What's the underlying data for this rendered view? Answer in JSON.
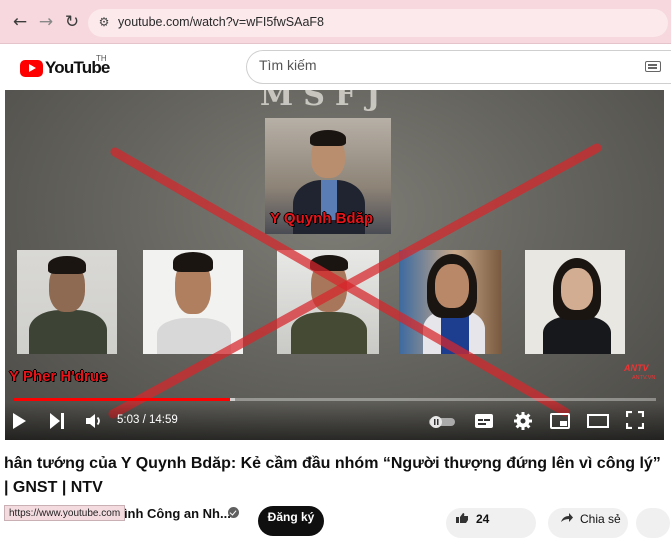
{
  "browser": {
    "url": "youtube.com/watch?v=wFI5fwSAaF8",
    "back_icon": "arrow-left-icon",
    "forward_icon": "arrow-right-icon",
    "reload_icon": "reload-icon"
  },
  "youtube": {
    "logo_text": "YouTube",
    "country_code": "TH",
    "search_placeholder": "Tìm kiếm"
  },
  "video": {
    "overlay_title": "MSFJ",
    "label_top": "Y Quynh Bdăp",
    "label_bottom": "Y Pher H'drue",
    "watermark": "ANTV",
    "watermark_sub": "ANTV.VN",
    "current_time": "5:03",
    "duration": "14:59",
    "time_display": "5:03 / 14:59",
    "progress_fraction": 0.337,
    "buffer_fraction": 0.345
  },
  "meta": {
    "title": "hân tướng của Y Quynh Bdăp: Kẻ cầm đầu nhóm “Người thượng đứng lên vì công lý” | GNST | NTV",
    "status_url": "https://www.youtube.com",
    "channel_name": "Truyền hình Công an Nh...",
    "channel_visible": "hình Công an Nh...",
    "subscribe_label": "Đăng ký",
    "like_count": "24",
    "share_label": "Chia sẻ"
  },
  "colors": {
    "brand_red": "#ff0000",
    "browser_bar": "#f6d8de",
    "label_red": "#e8141a"
  }
}
